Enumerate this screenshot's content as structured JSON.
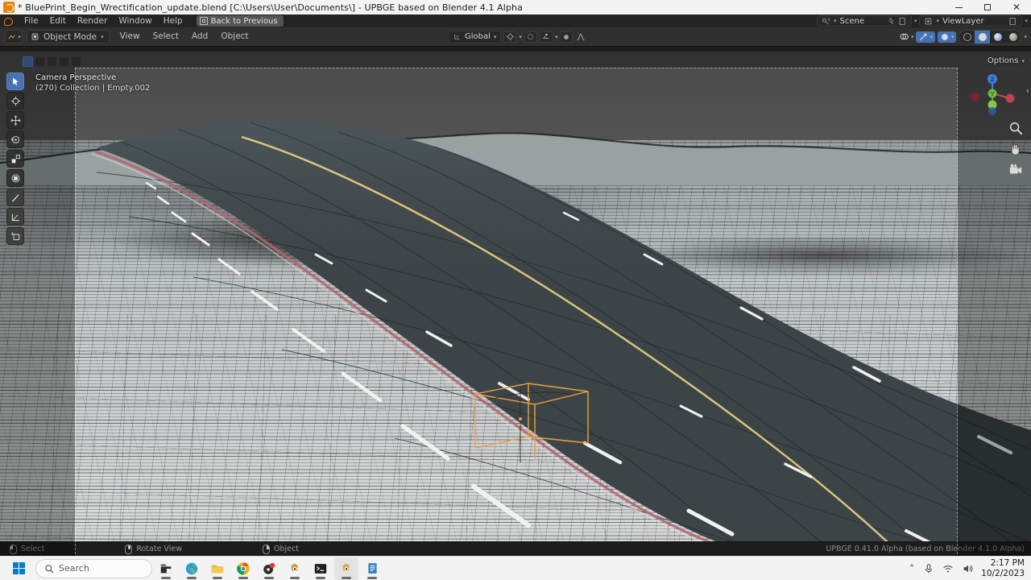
{
  "window": {
    "title": "* BluePrint_Begin_Wrectification_update.blend [C:\\Users\\User\\Documents\\] - UPBGE based on Blender 4.1 Alpha",
    "app_icon": "blender-icon",
    "controls": {
      "minimize": "minimize-icon",
      "maximize": "maximize-icon",
      "close": "close-icon"
    }
  },
  "topbar": {
    "logo": "blender-logo-icon",
    "menus": [
      "File",
      "Edit",
      "Render",
      "Window",
      "Help"
    ],
    "back_to_previous": "Back to Previous",
    "scene": {
      "label": "Scene",
      "icon": "scene-icon",
      "new_icon": "new-scene-icon"
    },
    "viewlayer": {
      "label": "ViewLayer",
      "icon": "viewlayer-icon",
      "new_icon": "new-viewlayer-icon"
    }
  },
  "toolheader": {
    "editor_type_icon": "editor-type-icon",
    "mode": "Object Mode",
    "menus": [
      "View",
      "Select",
      "Add",
      "Object"
    ],
    "transform_orientation": "Global",
    "orientation_icon": "orientation-icon",
    "snap_icon": "snap-magnet-icon",
    "snap_target_icon": "snap-target-icon",
    "proportional_icon": "proportional-editing-icon",
    "falloff_icon": "falloff-curve-icon",
    "overlays_icon": "overlays-icon",
    "xray_icon": "xray-icon",
    "viewport_shading_icon": "viewport-shading-icon",
    "shading_modes": [
      "wireframe",
      "solid",
      "material-preview",
      "rendered"
    ],
    "active_shading": "solid"
  },
  "viewport": {
    "view_name": "Camera Perspective",
    "scene_info": "(270) Collection | Empty.002",
    "options_label": "Options",
    "gizmo_axes": [
      "X",
      "Y",
      "Z"
    ],
    "side_tools": [
      "zoom-icon",
      "pan-hand-icon",
      "camera-view-icon"
    ],
    "colors": {
      "sky": "#505050",
      "terrain": "#c3c7c7",
      "road_asphalt": "#3d4447",
      "lane_marking": "#f2f2f2",
      "center_line": "#d8c173",
      "shoulder_edge": "#b3646a",
      "selection_outline": "#e8a33d",
      "accent_blue": "#4772b3"
    },
    "toolbar_tools": [
      "tweak-select-icon",
      "cursor-icon",
      "move-icon",
      "rotate-icon",
      "scale-icon",
      "transform-icon",
      "annotate-icon",
      "measure-icon",
      "add-cube-icon"
    ],
    "active_tool": "tweak-select-icon"
  },
  "statusbar": {
    "items": [
      {
        "icon": "mouse-left-icon",
        "label": "Select"
      },
      {
        "icon": "mouse-middle-icon",
        "label": "Rotate View"
      },
      {
        "icon": "mouse-right-icon",
        "label": "Object"
      }
    ],
    "version": "UPBGE 0.41.0 Alpha (based on Blender 4.1.0 Alpha)"
  },
  "taskbar": {
    "start_icon": "windows-start-icon",
    "search_placeholder": "Search",
    "search_icon": "search-icon",
    "apps": [
      {
        "name": "file-explorer-icon",
        "running": true
      },
      {
        "name": "weather-globe-icon",
        "running": true
      },
      {
        "name": "folder-icon",
        "running": true
      },
      {
        "name": "chrome-icon",
        "running": true
      },
      {
        "name": "media-icon",
        "running": true
      },
      {
        "name": "blender-app-icon",
        "running": true
      },
      {
        "name": "terminal-icon",
        "running": true
      },
      {
        "name": "upbge-app-icon",
        "running": true,
        "active": true
      },
      {
        "name": "notes-icon",
        "running": true
      }
    ],
    "tray": {
      "chevron": "show-hidden-icons-icon",
      "mic": "microphone-icon",
      "wifi": "wifi-icon",
      "volume": "volume-icon",
      "time": "2:17 PM",
      "date": "10/2/2023"
    }
  }
}
